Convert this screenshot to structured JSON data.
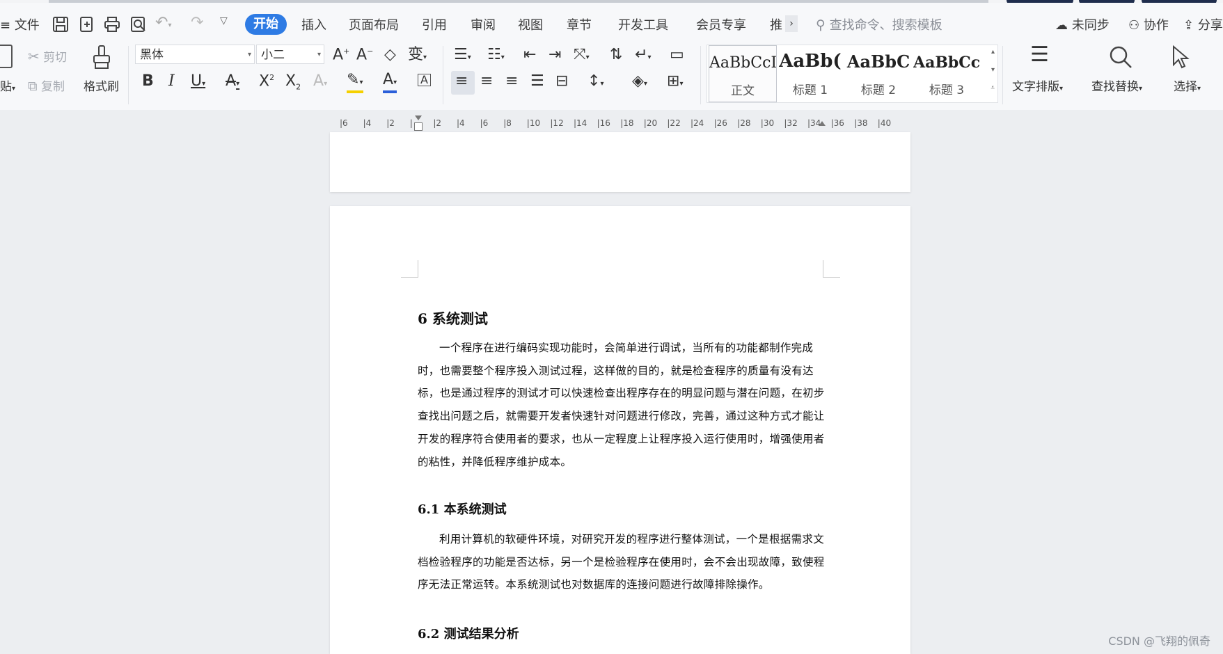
{
  "menubar": {
    "file": "文件",
    "tabs": [
      "开始",
      "插入",
      "页面布局",
      "引用",
      "审阅",
      "视图",
      "章节",
      "开发工具",
      "会员专享",
      "推"
    ],
    "search_placeholder": "查找命令、搜索模板",
    "right": {
      "sync": "未同步",
      "collab": "协作",
      "share": "分享"
    }
  },
  "ribbon": {
    "clipboard": {
      "paste": "贴",
      "cut": "剪切",
      "copy": "复制",
      "format_painter": "格式刷"
    },
    "font": {
      "family": "黑体",
      "size": "小二"
    },
    "styles": [
      {
        "preview": "AaBbCcI",
        "name": "正文"
      },
      {
        "preview": "AaBb(",
        "name": "标题 1"
      },
      {
        "preview": "AaBbC",
        "name": "标题 2"
      },
      {
        "preview": "AaBbCcI",
        "name": "标题 3"
      }
    ],
    "text_layout": "文字排版",
    "find_replace": "查找替换",
    "select": "选择"
  },
  "ruler": {
    "labels": [
      "6",
      "4",
      "2",
      "",
      "2",
      "4",
      "6",
      "8",
      "10",
      "12",
      "14",
      "16",
      "18",
      "20",
      "22",
      "24",
      "26",
      "28",
      "30",
      "32",
      "34",
      "36",
      "38",
      "40"
    ]
  },
  "document": {
    "h_6": "6 系统测试",
    "p_1": "一个程序在进行编码实现功能时，会简单进行调试，当所有的功能都制作完成时，也需要整个程序投入测试过程，这样做的目的，就是检查程序的质量有没有达标，也是通过程序的测试才可以快速检查出程序存在的明显问题与潜在问题，在初步查找出问题之后，就需要开发者快速针对问题进行修改，完善，通过这种方式才能让开发的程序符合使用者的要求，也从一定程度上让程序投入运行使用时，增强使用者的粘性，并降低程序维护成本。",
    "h_6_1": "6.1  本系统测试",
    "p_2": "利用计算机的软硬件环境，对研究开发的程序进行整体测试，一个是根据需求文档检验程序的功能是否达标，另一个是检验程序在使用时，会不会出现故障，致使程序无法正常运转。本系统测试也对数据库的连接问题进行故障排除操作。",
    "h_6_2": "6.2  测试结果分析"
  },
  "watermark": "CSDN @飞翔的佩奇",
  "colors": {
    "accent": "#2e7be4",
    "font_color_bar": "#2b5fd9",
    "highlight_bar": "#f5d000"
  }
}
